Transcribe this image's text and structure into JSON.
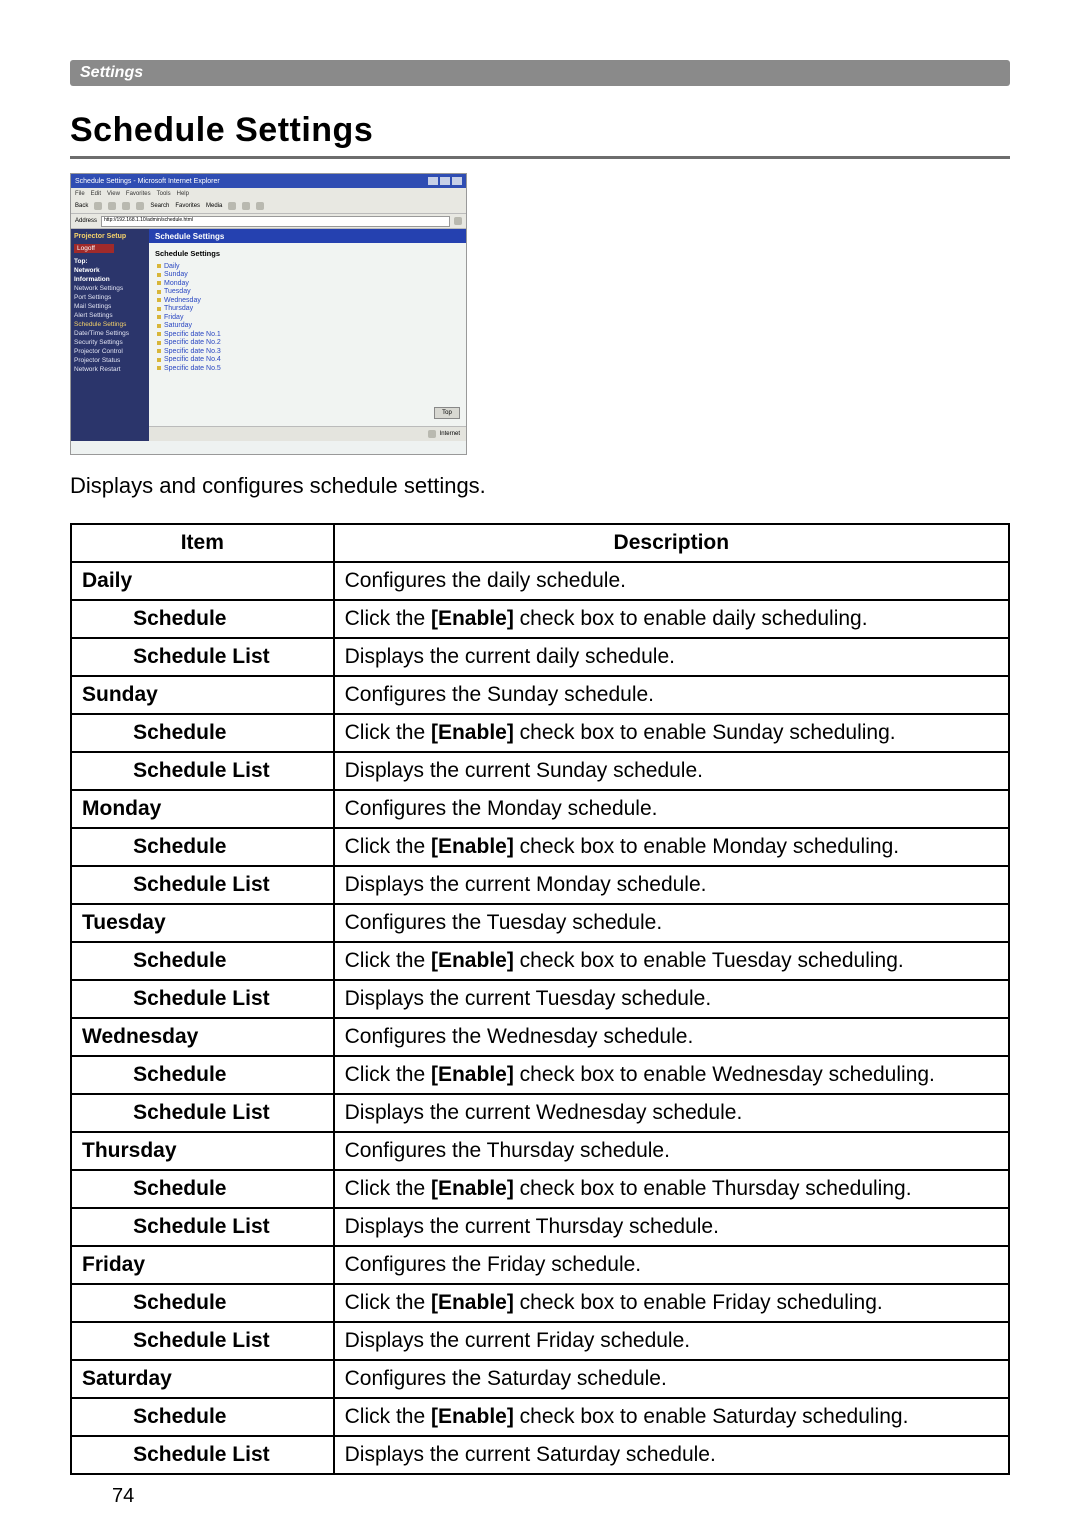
{
  "header_bar": {
    "label": "Settings"
  },
  "heading": "Schedule Settings",
  "intro": "Displays and configures schedule settings.",
  "page_number": "74",
  "screenshot": {
    "titlebar": "Schedule Settings - Microsoft Internet Explorer",
    "menu": [
      "File",
      "Edit",
      "View",
      "Favorites",
      "Tools",
      "Help"
    ],
    "toolbar_labels": [
      "Back",
      "Search",
      "Favorites",
      "Media"
    ],
    "address_label": "Address",
    "address_value": "http://192.168.1.10/admin/schedule.html",
    "sidebar": {
      "title": "Projector Setup",
      "logoff": "Logoff",
      "items": [
        {
          "label": "Top:",
          "bold": true
        },
        {
          "label": "Network",
          "bold": true
        },
        {
          "label": "Information",
          "bold": true
        },
        {
          "label": "Network Settings"
        },
        {
          "label": "Port Settings"
        },
        {
          "label": "Mail Settings"
        },
        {
          "label": "Alert Settings"
        },
        {
          "label": "Schedule Settings",
          "selected": true
        },
        {
          "label": "Date/Time Settings"
        },
        {
          "label": "Security Settings"
        },
        {
          "label": "Projector Control"
        },
        {
          "label": "Projector Status"
        },
        {
          "label": "Network Restart"
        }
      ]
    },
    "main": {
      "header": "Schedule Settings",
      "section_title": "Schedule Settings",
      "links": [
        "Daily",
        "Sunday",
        "Monday",
        "Tuesday",
        "Wednesday",
        "Thursday",
        "Friday",
        "Saturday",
        "Specific date No.1",
        "Specific date No.2",
        "Specific date No.3",
        "Specific date No.4",
        "Specific date No.5"
      ],
      "top_button": "Top",
      "status_right": "Internet"
    }
  },
  "table": {
    "headers": {
      "item": "Item",
      "description": "Description"
    },
    "rows": [
      {
        "type": "group",
        "item": "Daily",
        "desc": "Configures the daily schedule."
      },
      {
        "type": "sub",
        "item": "Schedule",
        "desc_pre": "Click the ",
        "desc_bold": "[Enable]",
        "desc_post": " check box to enable daily scheduling."
      },
      {
        "type": "sub",
        "item": "Schedule List",
        "desc": "Displays the current daily schedule."
      },
      {
        "type": "group",
        "item": "Sunday",
        "desc": "Configures the Sunday schedule."
      },
      {
        "type": "sub",
        "item": "Schedule",
        "desc_pre": "Click the ",
        "desc_bold": "[Enable]",
        "desc_post": " check box to enable Sunday scheduling."
      },
      {
        "type": "sub",
        "item": "Schedule List",
        "desc": "Displays the current Sunday schedule."
      },
      {
        "type": "group",
        "item": "Monday",
        "desc": "Configures the Monday schedule."
      },
      {
        "type": "sub",
        "item": "Schedule",
        "desc_pre": "Click the ",
        "desc_bold": "[Enable]",
        "desc_post": " check box to enable Monday scheduling."
      },
      {
        "type": "sub",
        "item": "Schedule List",
        "desc": "Displays the current Monday schedule."
      },
      {
        "type": "group",
        "item": "Tuesday",
        "desc": "Configures the Tuesday schedule."
      },
      {
        "type": "sub",
        "item": "Schedule",
        "desc_pre": "Click the ",
        "desc_bold": "[Enable]",
        "desc_post": " check box to enable Tuesday scheduling."
      },
      {
        "type": "sub",
        "item": "Schedule List",
        "desc": "Displays the current Tuesday schedule."
      },
      {
        "type": "group",
        "item": "Wednesday",
        "desc": "Configures the Wednesday schedule."
      },
      {
        "type": "sub",
        "item": "Schedule",
        "desc_pre": "Click the ",
        "desc_bold": "[Enable]",
        "desc_post": " check box to enable Wednesday scheduling."
      },
      {
        "type": "sub",
        "item": "Schedule List",
        "desc": "Displays the current Wednesday schedule."
      },
      {
        "type": "group",
        "item": "Thursday",
        "desc": "Configures the Thursday schedule."
      },
      {
        "type": "sub",
        "item": "Schedule",
        "desc_pre": "Click the ",
        "desc_bold": "[Enable]",
        "desc_post": " check box to enable Thursday scheduling."
      },
      {
        "type": "sub",
        "item": "Schedule List",
        "desc": "Displays the current Thursday schedule."
      },
      {
        "type": "group",
        "item": "Friday",
        "desc": "Configures the Friday schedule."
      },
      {
        "type": "sub",
        "item": "Schedule",
        "desc_pre": "Click the ",
        "desc_bold": "[Enable]",
        "desc_post": " check box to enable Friday scheduling."
      },
      {
        "type": "sub",
        "item": "Schedule List",
        "desc": "Displays the current Friday schedule."
      },
      {
        "type": "group",
        "item": "Saturday",
        "desc": "Configures the Saturday schedule."
      },
      {
        "type": "sub",
        "item": "Schedule",
        "desc_pre": "Click the ",
        "desc_bold": "[Enable]",
        "desc_post": " check box to enable Saturday scheduling."
      },
      {
        "type": "sub",
        "item": "Schedule List",
        "desc": "Displays the current Saturday schedule."
      }
    ]
  }
}
